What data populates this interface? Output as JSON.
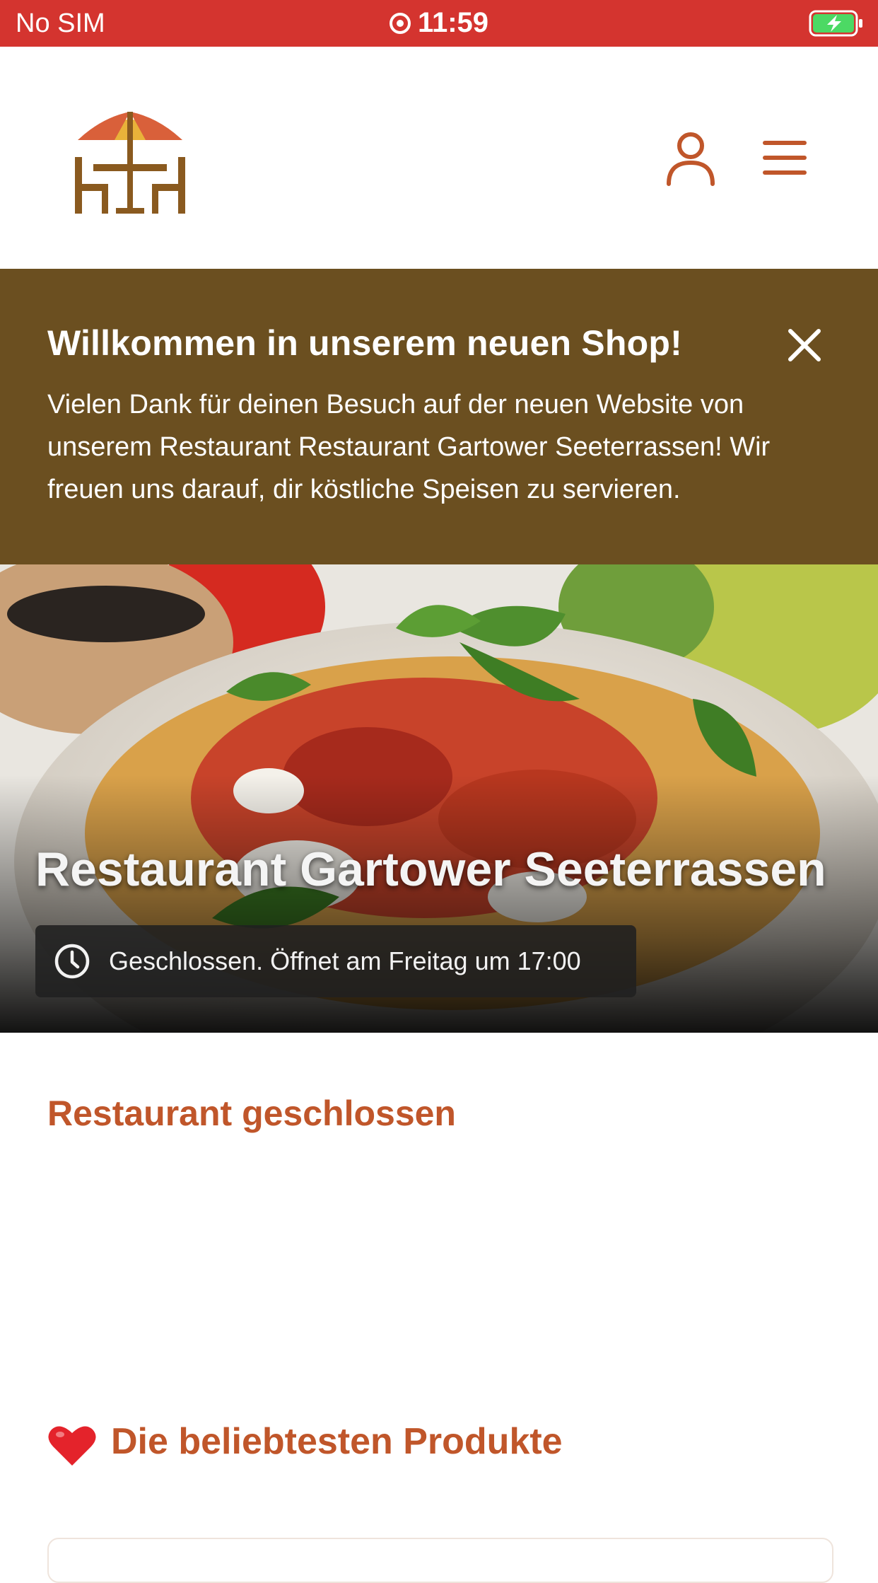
{
  "status_bar": {
    "carrier": "No SIM",
    "time": "11:59",
    "battery_color": "#4cd964"
  },
  "header": {
    "logo_icon": "restaurant-table-umbrella-icon",
    "user_icon": "user-icon",
    "menu_icon": "hamburger-menu-icon"
  },
  "banner": {
    "title": "Willkommen in unserem neuen Shop!",
    "text": "Vielen Dank für deinen Besuch auf der neuen Website von unserem Restaurant Restaurant Gartower Seeterrassen! Wir freuen uns darauf, dir köstliche Speisen zu servieren.",
    "close_icon": "close-icon",
    "background": "#6b4f20"
  },
  "hero": {
    "title": "Restaurant Gartower Seeterrassen",
    "status": "Geschlossen. Öffnet am Freitag um 17:00",
    "status_icon": "clock-icon"
  },
  "main": {
    "closed_heading": "Restaurant geschlossen",
    "popular_heading": "Die beliebtesten Produkte",
    "popular_icon": "heart-icon",
    "accent": "#c0562a"
  }
}
